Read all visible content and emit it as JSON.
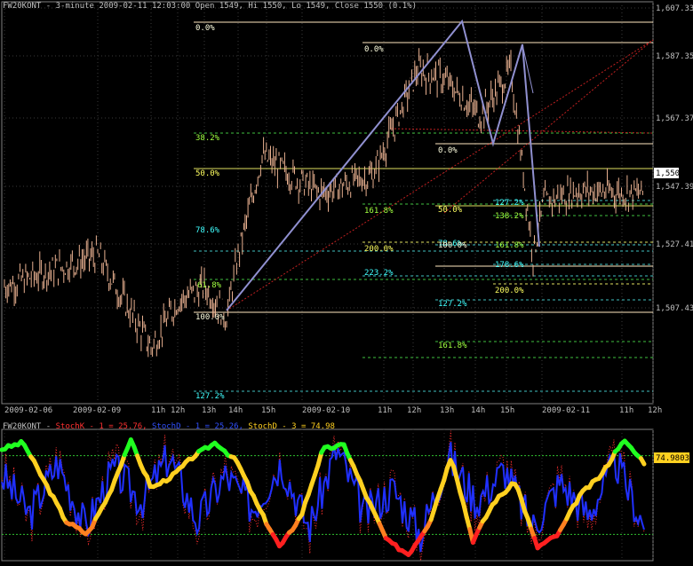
{
  "header": {
    "text": "FW20KONT - 3-minute 2009-02-11 12:03:00 Open 1549, Hi 1550, Lo 1549, Close 1550 (0.1%)"
  },
  "price_axis": {
    "ticks": [
      "1,607.33",
      "1,587.35",
      "1,567.37",
      "1,547.39",
      "1,527.41",
      "1,507.43"
    ],
    "current_label": "1,550"
  },
  "time_axis": {
    "ticks": [
      "2009-02-06",
      "2009-02-09",
      "11h",
      "12h",
      "13h",
      "14h",
      "15h",
      "2009-02-10",
      "11h",
      "12h",
      "13h",
      "14h",
      "15h",
      "2009-02-11",
      "11h",
      "12h"
    ]
  },
  "indicator": {
    "name": "FW20KONT",
    "k_label": "StochK - 1 = 25.76,",
    "d1_label": "StochD - 1 = 25.26,",
    "d3_label": "StochD - 3 = 74.98",
    "current_label": "74.9803"
  },
  "chart_data": [
    {
      "type": "line",
      "title": "FW20KONT - 3-minute",
      "ylim": [
        1482,
        1612
      ],
      "x": [
        "2009-02-06",
        "2009-02-09 open",
        "2009-02-09 11h",
        "2009-02-09 12h",
        "2009-02-09 13h",
        "2009-02-09 13h30",
        "2009-02-09 14h",
        "2009-02-09 15h",
        "2009-02-10",
        "2009-02-10 11h",
        "2009-02-10 12h",
        "2009-02-10 13h",
        "2009-02-10 14h",
        "2009-02-10 15h",
        "2009-02-10 close",
        "2009-02-11",
        "2009-02-11 11h",
        "2009-02-11 12h"
      ],
      "series": [
        {
          "values": [
            1520,
            1530,
            1500,
            1515,
            1520,
            1510,
            1530,
            1562,
            1550,
            1556,
            1590,
            1587,
            1575,
            1590,
            1530,
            1547,
            1551,
            1550
          ]
        }
      ],
      "zigzag": [
        {
          "x": "2009-02-09 13h30",
          "y": 1508
        },
        {
          "x": "2009-02-10 12h",
          "y": 1603
        },
        {
          "x": "2009-02-10 14h",
          "y": 1558
        },
        {
          "x": "2009-02-10 15h",
          "y": 1592
        },
        {
          "x": "2009-02-11",
          "y": 1527
        }
      ],
      "fibonacci_labels": [
        {
          "text": "0.0%",
          "color": "#ffffe0"
        },
        {
          "text": "38.2%",
          "color": "#a0ff40"
        },
        {
          "text": "50.0%",
          "color": "#ffff60"
        },
        {
          "text": "78.6%",
          "color": "#40ffff"
        },
        {
          "text": "61.8%",
          "color": "#a0ff40"
        },
        {
          "text": "100.0%",
          "color": "#ffffe0"
        },
        {
          "text": "127.2%",
          "color": "#40ffff"
        },
        {
          "text": "0.0%",
          "color": "#ffffe0"
        },
        {
          "text": "161.8%",
          "color": "#a0ff40"
        },
        {
          "text": "200.0%",
          "color": "#ffff60"
        },
        {
          "text": "223.2%",
          "color": "#40ffff"
        },
        {
          "text": "0.0%",
          "color": "#ffffe0"
        },
        {
          "text": "50.0%",
          "color": "#ffff60"
        },
        {
          "text": "78.6%",
          "color": "#40ffff"
        },
        {
          "text": "100.0%",
          "color": "#ffffe0"
        },
        {
          "text": "127.2%",
          "color": "#40ffff"
        },
        {
          "text": "161.8%",
          "color": "#a0ff40"
        },
        {
          "text": "127.2%",
          "color": "#40ffff"
        },
        {
          "text": "138.2%",
          "color": "#a0ff40"
        },
        {
          "text": "161.8%",
          "color": "#a0ff40"
        },
        {
          "text": "178.6%",
          "color": "#40ffff"
        },
        {
          "text": "200.0%",
          "color": "#ffff60"
        }
      ],
      "colors": {
        "candle": "#e8b090",
        "zigzag": "#9090d0",
        "channel": "#c02020"
      },
      "grid": true
    },
    {
      "type": "line",
      "title": "StochK / StochD",
      "ylim": [
        0,
        100
      ],
      "series": [
        {
          "name": "StochK - 1",
          "values": [
            70,
            30,
            80,
            20,
            75,
            40,
            85,
            25,
            70,
            35,
            80,
            20,
            90,
            30,
            60,
            15,
            85,
            40,
            75,
            20,
            65,
            30,
            80,
            25
          ]
        },
        {
          "name": "StochD - 1",
          "values": [
            65,
            35,
            75,
            25,
            70,
            45,
            80,
            30,
            65,
            40,
            75,
            25,
            85,
            35,
            55,
            20,
            80,
            45,
            70,
            25,
            60,
            35,
            75,
            26
          ]
        },
        {
          "name": "StochD - 3",
          "values": [
            85,
            90,
            60,
            30,
            20,
            50,
            92,
            55,
            65,
            80,
            90,
            75,
            40,
            10,
            35,
            85,
            88,
            50,
            15,
            5,
            30,
            80,
            15,
            45,
            60,
            10,
            20,
            50,
            65,
            92,
            75
          ]
        }
      ],
      "levels": [
        80,
        20
      ],
      "colors": {
        "k": "#ff3030",
        "d1": "#2030ff",
        "d3": "#ffd020",
        "overbought": "#20ff20",
        "oversold": "#ff2020",
        "transition": "#ff8020"
      }
    }
  ]
}
